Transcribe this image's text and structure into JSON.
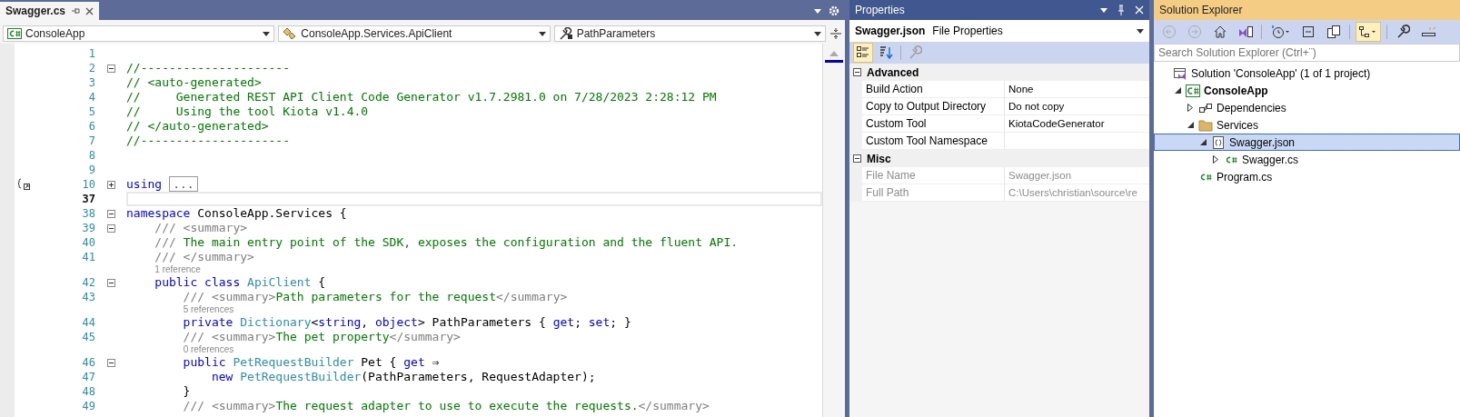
{
  "editor": {
    "tab": {
      "title": "Swagger.cs",
      "selected": true
    },
    "nav": [
      "ConsoleApp",
      "ConsoleApp.Services.ApiClient",
      "PathParameters"
    ],
    "lines": [
      {
        "kind": "code",
        "number": "1",
        "current": false
      },
      {
        "kind": "code",
        "number": "2",
        "expanded": true,
        "current": false,
        "tokens": [
          {
            "kind": "comment",
            "text": "//---------------------"
          }
        ]
      },
      {
        "kind": "code",
        "number": "3",
        "current": false,
        "tokens": [
          {
            "kind": "comment",
            "text": "// <auto-generated>"
          }
        ]
      },
      {
        "kind": "code",
        "number": "4",
        "current": false,
        "tokens": [
          {
            "kind": "comment",
            "text": "//     Generated REST API Client Code Generator v1.7.2981.0 on 7/28/2023 2:28:12 PM"
          }
        ]
      },
      {
        "kind": "code",
        "number": "5",
        "current": false,
        "tokens": [
          {
            "kind": "comment",
            "text": "//     Using the tool Kiota v1.4.0"
          }
        ]
      },
      {
        "kind": "code",
        "number": "6",
        "current": false,
        "tokens": [
          {
            "kind": "comment",
            "text": "// </auto-generated>"
          }
        ]
      },
      {
        "kind": "code",
        "number": "7",
        "current": false,
        "tokens": [
          {
            "kind": "comment",
            "text": "//---------------------"
          }
        ]
      },
      {
        "kind": "code",
        "number": "8",
        "current": false
      },
      {
        "kind": "code",
        "number": "9",
        "current": false
      },
      {
        "kind": "code",
        "number": "10",
        "expanded": false,
        "scope_marker": true,
        "current": false,
        "tokens": [
          {
            "kind": "keyword",
            "text": "using"
          },
          {
            "kind": "collapsed",
            "text": "..."
          }
        ]
      },
      {
        "kind": "code",
        "number": "37",
        "current": true
      },
      {
        "kind": "code",
        "number": "38",
        "expanded": true,
        "current": false,
        "tokens": [
          {
            "kind": "keyword",
            "text": "namespace"
          },
          {
            "kind": "plain",
            "text": " ConsoleApp.Services {"
          }
        ]
      },
      {
        "kind": "code",
        "number": "39",
        "expanded": true,
        "current": false,
        "tokens": [
          {
            "kind": "doc",
            "text": "    /// <summary>"
          }
        ]
      },
      {
        "kind": "code",
        "number": "40",
        "current": false,
        "tokens": [
          {
            "kind": "doc",
            "text": "    /// "
          },
          {
            "kind": "comment",
            "text": "The main entry point of the SDK, exposes the configuration and the fluent API."
          }
        ]
      },
      {
        "kind": "code",
        "number": "41",
        "current": false,
        "tokens": [
          {
            "kind": "doc",
            "text": "    /// </summary>"
          }
        ]
      },
      {
        "kind": "lens",
        "text": "1 reference"
      },
      {
        "kind": "code",
        "number": "42",
        "expanded": true,
        "current": false,
        "tokens": [
          {
            "kind": "keyword",
            "text": "    public class "
          },
          {
            "kind": "type",
            "text": "ApiClient"
          },
          {
            "kind": "plain",
            "text": " {"
          }
        ]
      },
      {
        "kind": "code",
        "number": "43",
        "current": false,
        "tokens": [
          {
            "kind": "doc",
            "text": "        /// <summary>"
          },
          {
            "kind": "comment",
            "text": "Path parameters for the request"
          },
          {
            "kind": "doc",
            "text": "</summary>"
          }
        ]
      },
      {
        "kind": "lens",
        "text": "5 references"
      },
      {
        "kind": "code",
        "number": "44",
        "current": false,
        "tokens": [
          {
            "kind": "keyword",
            "text": "        private "
          },
          {
            "kind": "type",
            "text": "Dictionary"
          },
          {
            "kind": "plain",
            "text": "<"
          },
          {
            "kind": "keyword",
            "text": "string"
          },
          {
            "kind": "plain",
            "text": ", "
          },
          {
            "kind": "keyword",
            "text": "object"
          },
          {
            "kind": "plain",
            "text": "> PathParameters { "
          },
          {
            "kind": "keyword",
            "text": "get"
          },
          {
            "kind": "plain",
            "text": "; "
          },
          {
            "kind": "keyword",
            "text": "set"
          },
          {
            "kind": "plain",
            "text": "; }"
          }
        ]
      },
      {
        "kind": "code",
        "number": "45",
        "current": false,
        "tokens": [
          {
            "kind": "doc",
            "text": "        /// <summary>"
          },
          {
            "kind": "comment",
            "text": "The pet property"
          },
          {
            "kind": "doc",
            "text": "</summary>"
          }
        ]
      },
      {
        "kind": "lens",
        "text": "0 references"
      },
      {
        "kind": "code",
        "number": "46",
        "expanded": true,
        "current": false,
        "tokens": [
          {
            "kind": "keyword",
            "text": "        public "
          },
          {
            "kind": "type",
            "text": "PetRequestBuilder"
          },
          {
            "kind": "plain",
            "text": " Pet { "
          },
          {
            "kind": "keyword",
            "text": "get"
          },
          {
            "kind": "plain",
            "text": " ⇒"
          }
        ]
      },
      {
        "kind": "code",
        "number": "47",
        "current": false,
        "tokens": [
          {
            "kind": "keyword",
            "text": "            new "
          },
          {
            "kind": "type",
            "text": "PetRequestBuilder"
          },
          {
            "kind": "plain",
            "text": "(PathParameters, RequestAdapter);"
          }
        ]
      },
      {
        "kind": "code",
        "number": "48",
        "current": false,
        "tokens": [
          {
            "kind": "plain",
            "text": "        }"
          }
        ]
      },
      {
        "kind": "code",
        "number": "49",
        "current": false,
        "tokens": [
          {
            "kind": "doc",
            "text": "        /// <summary>"
          },
          {
            "kind": "comment",
            "text": "The request adapter to use to execute the requests."
          },
          {
            "kind": "doc",
            "text": "</summary>"
          }
        ]
      }
    ]
  },
  "properties": {
    "title": "Properties",
    "object_name": "Swagger.json",
    "object_type": "File Properties",
    "toolbar": [
      {
        "kind": "categorized",
        "selected": true,
        "disabled": false
      },
      {
        "kind": "alphabetical",
        "selected": false,
        "disabled": false
      },
      {
        "kind": "pages",
        "selected": false,
        "disabled": true
      }
    ],
    "categories": [
      {
        "name": "Advanced",
        "expanded": true,
        "rows": [
          {
            "name": "Build Action",
            "value": "None",
            "disabled": false
          },
          {
            "name": "Copy to Output Directory",
            "value": "Do not copy",
            "disabled": false
          },
          {
            "name": "Custom Tool",
            "value": "KiotaCodeGenerator",
            "disabled": false
          },
          {
            "name": "Custom Tool Namespace",
            "disabled": false
          }
        ]
      },
      {
        "name": "Misc",
        "expanded": true,
        "rows": [
          {
            "name": "File Name",
            "value": "Swagger.json",
            "disabled": true
          },
          {
            "name": "Full Path",
            "value": "C:\\Users\\christian\\source\\re",
            "disabled": true
          }
        ]
      }
    ]
  },
  "solution_explorer": {
    "title": "Solution Explorer",
    "search": {
      "placeholder": "Search Solution Explorer (Ctrl+¨)"
    },
    "toolbar": [
      {
        "kind": "back",
        "selected": false
      },
      {
        "kind": "forward",
        "selected": false
      },
      {
        "kind": "home",
        "selected": false
      },
      {
        "kind": "vs-switch",
        "selected": false
      },
      {
        "kind": "pending",
        "selected": false
      },
      {
        "kind": "collapse",
        "selected": false
      },
      {
        "kind": "copy",
        "selected": false
      },
      {
        "kind": "sync",
        "selected": true
      },
      {
        "kind": "properties",
        "selected": false
      },
      {
        "kind": "preview",
        "selected": false
      }
    ],
    "tree": [
      {
        "label": "Solution 'ConsoleApp' (1 of 1 project)",
        "kind": "solution",
        "selected": false,
        "children": [
          {
            "label": "ConsoleApp",
            "kind": "project",
            "expanded": true,
            "selected": false,
            "children": [
              {
                "label": "Dependencies",
                "kind": "dependencies",
                "expanded": false,
                "selected": false
              },
              {
                "label": "Services",
                "kind": "folder",
                "expanded": true,
                "selected": false,
                "children": [
                  {
                    "label": "Swagger.json",
                    "kind": "json",
                    "expanded": true,
                    "selected": true,
                    "children": [
                      {
                        "label": "Swagger.cs",
                        "kind": "csharp",
                        "expanded": false,
                        "selected": false
                      }
                    ]
                  }
                ]
              },
              {
                "label": "Program.cs",
                "kind": "csharp",
                "selected": false
              }
            ]
          }
        ]
      }
    ]
  }
}
